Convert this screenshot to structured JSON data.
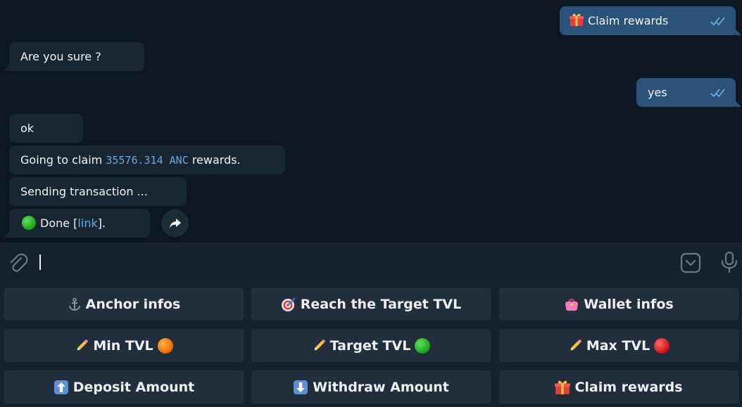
{
  "colors": {
    "chat_bg": "#0e1621",
    "incoming_bubble": "#182533",
    "outgoing_bubble": "#2b5278",
    "keyboard_bg": "#17212b",
    "keyboard_button": "#232e3c",
    "link": "#6aa9e0",
    "check": "#6aa9e0"
  },
  "messages": [
    {
      "id": "m1",
      "direction": "out",
      "text": "Claim rewards",
      "icon": "gift-icon",
      "status": "read-double-check"
    },
    {
      "id": "m2",
      "direction": "in",
      "text": "Are you sure ?"
    },
    {
      "id": "m3",
      "direction": "out",
      "text": "yes",
      "status": "read-double-check"
    },
    {
      "id": "m4",
      "direction": "in",
      "text": "ok"
    },
    {
      "id": "m5",
      "direction": "in",
      "prefix": "Going to claim ",
      "amount": "35576.314 ANC",
      "suffix": " rewards."
    },
    {
      "id": "m6",
      "direction": "in",
      "text": "Sending transaction ..."
    },
    {
      "id": "m7",
      "direction": "in",
      "icon": "green-circle-icon",
      "prefix": "Done [",
      "link_text": "link",
      "suffix": "]."
    }
  ],
  "input": {
    "value": "",
    "icons": [
      "paperclip-icon",
      "sticker-icon",
      "microphone-icon"
    ]
  },
  "keyboard": {
    "rows": [
      [
        {
          "label": "Anchor infos",
          "icon": "anchor-icon"
        },
        {
          "label": "Reach the Target TVL",
          "icon": "target-icon"
        },
        {
          "label": "Wallet infos",
          "icon": "purse-icon"
        }
      ],
      [
        {
          "label": "Min TVL",
          "icon": "pencil-icon",
          "trail_icon": "orange-circle-icon"
        },
        {
          "label": "Target TVL",
          "icon": "pencil-icon",
          "trail_icon": "green-circle-icon"
        },
        {
          "label": "Max TVL",
          "icon": "pencil-icon",
          "trail_icon": "red-circle-icon"
        }
      ],
      [
        {
          "label": "Deposit Amount",
          "icon": "up-arrow-icon"
        },
        {
          "label": "Withdraw Amount",
          "icon": "down-arrow-icon"
        },
        {
          "label": "Claim rewards",
          "icon": "gift-icon"
        }
      ]
    ]
  }
}
